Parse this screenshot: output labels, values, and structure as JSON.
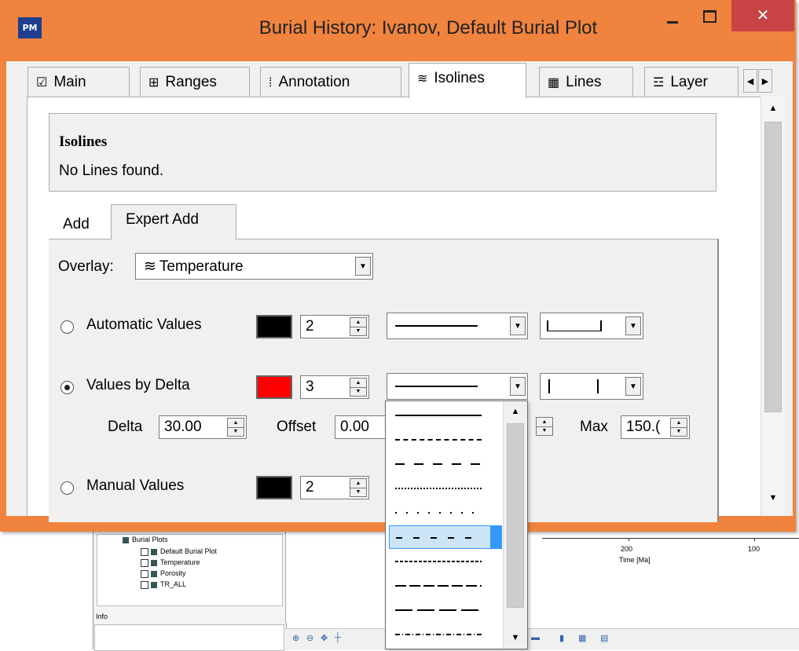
{
  "background_app": {
    "tree": {
      "root_label": "Burial Plots",
      "items": [
        "Default Burial Plot",
        "Temperature",
        "Porosity",
        "TR_ALL"
      ]
    },
    "info_label": "Info",
    "plot": {
      "tick_labels": [
        "200",
        "100"
      ],
      "axis_label": "Time [Ma]"
    }
  },
  "window": {
    "icon_text": "PM",
    "title": "Burial History: Ivanov,  Default Burial Plot",
    "close_glyph": "✕",
    "accent_color": "#f0843e"
  },
  "tabs": [
    {
      "label": "Main",
      "icon": "chart-icon",
      "glyph": "☑"
    },
    {
      "label": "Ranges",
      "icon": "ranges-icon",
      "glyph": "⊞"
    },
    {
      "label": "Annotation",
      "icon": "annotation-icon",
      "glyph": "⁞"
    },
    {
      "label": "Isolines",
      "icon": "isolines-icon",
      "glyph": "≋"
    },
    {
      "label": "Lines",
      "icon": "lines-icon",
      "glyph": "▦"
    },
    {
      "label": "Layer",
      "icon": "layer-icon",
      "glyph": "☲"
    }
  ],
  "active_tab": "Isolines",
  "isolines_box": {
    "title": "Isolines",
    "message": "No Lines found."
  },
  "subtabs": [
    {
      "label": "Add"
    },
    {
      "label": "Expert Add"
    }
  ],
  "active_subtab": "Expert Add",
  "overlay": {
    "label": "Overlay:",
    "value": "Temperature",
    "icon": "isolines-icon"
  },
  "rows": {
    "automatic": {
      "label": "Automatic Values",
      "selected": false,
      "color": "#000000",
      "width": "2"
    },
    "delta": {
      "label": "Values by Delta",
      "selected": true,
      "color": "#ff0000",
      "width": "3"
    },
    "manual": {
      "label": "Manual Values",
      "selected": false,
      "color": "#000000",
      "width": "2"
    }
  },
  "delta_fields": {
    "delta_label": "Delta",
    "delta_value": "30.00",
    "offset_label": "Offset",
    "offset_value": "0.00",
    "max_label": "Max",
    "max_value": "150.("
  },
  "dropdown": {
    "items": [
      "solid",
      "dashed-short",
      "dashed-long",
      "dotted",
      "dotted-sparse",
      "dash-sparse",
      "dashed-fine",
      "dashed-medium",
      "long-dash",
      "dash-dot"
    ],
    "selected_index": 5
  }
}
